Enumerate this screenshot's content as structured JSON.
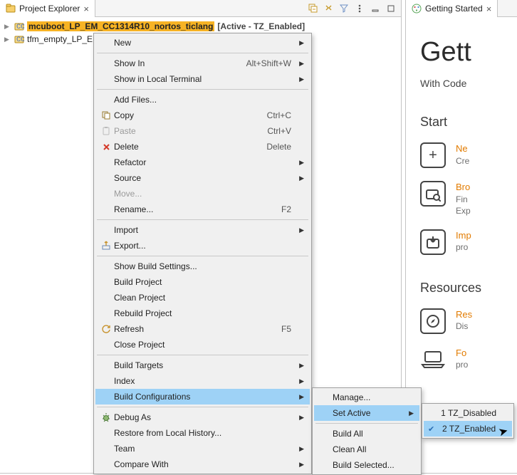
{
  "explorer": {
    "tab_label": "Project Explorer",
    "projects": [
      {
        "label": "mcuboot_LP_EM_CC1314R10_nortos_ticlang",
        "annot": " [Active - TZ_Enabled]",
        "selected": true
      },
      {
        "label": "tfm_empty_LP_E",
        "annot": "",
        "selected": false
      }
    ]
  },
  "gs": {
    "tab_label": "Getting Started",
    "h1": "Gett",
    "sub": "With Code",
    "start_heading": "Start",
    "start_items": [
      {
        "title": "Ne",
        "desc": "Cre"
      },
      {
        "title": "Bro",
        "desc": "Fin\nExp"
      },
      {
        "title": "Imp",
        "desc": "pro"
      }
    ],
    "resources_heading": "Resources",
    "resources_items": [
      {
        "title": "Res",
        "desc": "Dis"
      },
      {
        "title": "Fo",
        "desc": "pro"
      }
    ]
  },
  "context_menu": {
    "items": [
      {
        "label": "New",
        "submenu": true
      },
      "sep",
      {
        "label": "Show In",
        "accel": "Alt+Shift+W",
        "submenu": true
      },
      {
        "label": "Show in Local Terminal",
        "submenu": true
      },
      "sep",
      {
        "label": "Add Files..."
      },
      {
        "label": "Copy",
        "accel": "Ctrl+C",
        "icon": "copy"
      },
      {
        "label": "Paste",
        "accel": "Ctrl+V",
        "icon": "paste",
        "disabled": true
      },
      {
        "label": "Delete",
        "accel": "Delete",
        "icon": "delete"
      },
      {
        "label": "Refactor",
        "submenu": true
      },
      {
        "label": "Source",
        "submenu": true
      },
      {
        "label": "Move...",
        "disabled": true
      },
      {
        "label": "Rename...",
        "accel": "F2"
      },
      "sep",
      {
        "label": "Import",
        "submenu": true
      },
      {
        "label": "Export...",
        "icon": "export"
      },
      "sep",
      {
        "label": "Show Build Settings..."
      },
      {
        "label": "Build Project"
      },
      {
        "label": "Clean Project"
      },
      {
        "label": "Rebuild Project"
      },
      {
        "label": "Refresh",
        "accel": "F5",
        "icon": "refresh"
      },
      {
        "label": "Close Project"
      },
      "sep",
      {
        "label": "Build Targets",
        "submenu": true
      },
      {
        "label": "Index",
        "submenu": true
      },
      {
        "label": "Build Configurations",
        "submenu": true,
        "highlight": true
      },
      "sep",
      {
        "label": "Debug As",
        "submenu": true,
        "icon": "debug"
      },
      {
        "label": "Restore from Local History..."
      },
      {
        "label": "Team",
        "submenu": true
      },
      {
        "label": "Compare With",
        "submenu": true
      }
    ]
  },
  "submenu_bc": {
    "items": [
      {
        "label": "Manage..."
      },
      {
        "label": "Set Active",
        "submenu": true,
        "highlight": true
      },
      "sep",
      {
        "label": "Build All"
      },
      {
        "label": "Clean All"
      },
      {
        "label": "Build Selected..."
      }
    ]
  },
  "submenu_sa": {
    "items": [
      {
        "label": "1 TZ_Disabled"
      },
      {
        "label": "2 TZ_Enabled",
        "highlight": true,
        "checked": true
      }
    ]
  }
}
